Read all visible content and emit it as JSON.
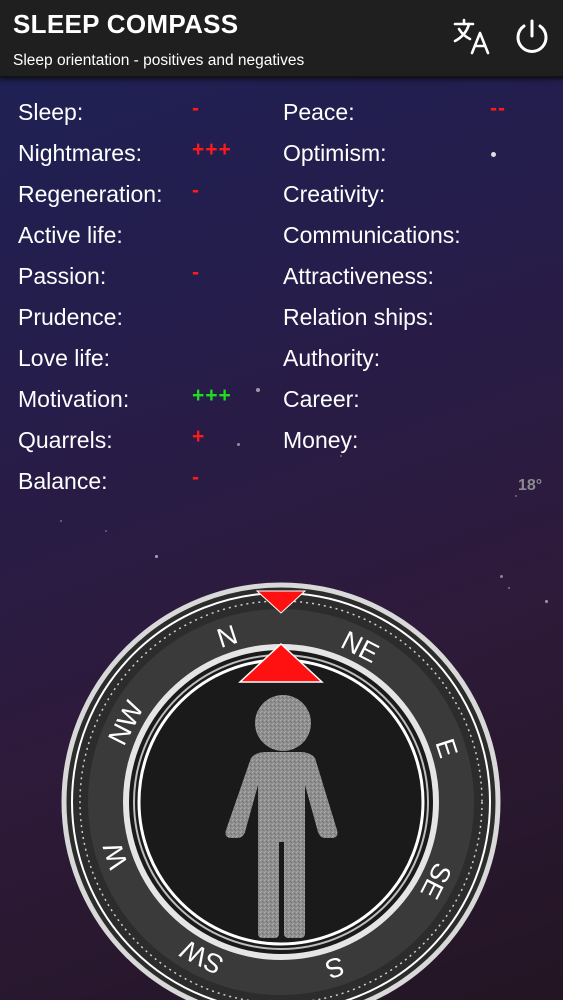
{
  "app": {
    "title": "SLEEP COMPASS",
    "subtitle": "Sleep orientation - positives and negatives"
  },
  "actions": {
    "translate_icon": "translate-icon",
    "power_icon": "power-icon"
  },
  "left_column": [
    {
      "label": "Sleep:",
      "value": "-",
      "kind": "negative"
    },
    {
      "label": "Nightmares:",
      "value": "+++",
      "kind": "negative"
    },
    {
      "label": "Regeneration:",
      "value": "-",
      "kind": "negative"
    },
    {
      "label": "Active life:",
      "value": "",
      "kind": "neutral"
    },
    {
      "label": "Passion:",
      "value": "-",
      "kind": "negative"
    },
    {
      "label": "Prudence:",
      "value": "",
      "kind": "neutral"
    },
    {
      "label": "Love life:",
      "value": "",
      "kind": "neutral"
    },
    {
      "label": "Motivation:",
      "value": "+++",
      "kind": "positive"
    },
    {
      "label": "Quarrels:",
      "value": "+",
      "kind": "negative"
    },
    {
      "label": "Balance:",
      "value": "-",
      "kind": "negative"
    }
  ],
  "right_column": [
    {
      "label": "Peace:",
      "value": "--",
      "kind": "negative"
    },
    {
      "label": "Optimism:",
      "value": "",
      "kind": "neutral"
    },
    {
      "label": "Creativity:",
      "value": "",
      "kind": "neutral"
    },
    {
      "label": "Communications:",
      "value": "",
      "kind": "neutral"
    },
    {
      "label": "Attractiveness:",
      "value": "",
      "kind": "neutral"
    },
    {
      "label": "Relation ships:",
      "value": "",
      "kind": "neutral"
    },
    {
      "label": "Authority:",
      "value": "",
      "kind": "neutral"
    },
    {
      "label": "Career:",
      "value": "",
      "kind": "neutral"
    },
    {
      "label": "Money:",
      "value": "",
      "kind": "neutral"
    }
  ],
  "heading": {
    "text": "18°",
    "degrees": 18
  },
  "compass": {
    "directions": [
      "N",
      "NE",
      "E",
      "SE",
      "S",
      "SW",
      "W",
      "NW"
    ],
    "figure_icon": "person-icon"
  },
  "colors": {
    "negative": "#ff1a1a",
    "positive": "#1fdc1f",
    "marker": "#ff1111",
    "appbar": "#1f1f1f"
  }
}
